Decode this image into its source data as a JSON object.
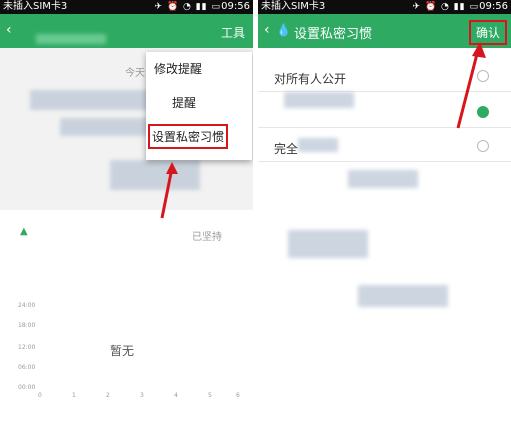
{
  "left": {
    "status": {
      "carrier": "未插入SIM卡3",
      "time": "09:56"
    },
    "appbar": {
      "tools_label": "工具",
      "title": ""
    },
    "menu": {
      "items": [
        {
          "label": "修改提醒"
        },
        {
          "label": "提醒"
        },
        {
          "label": "设置私密习惯"
        }
      ]
    },
    "texts": {
      "today": "今天",
      "kept": "已坚持",
      "pause": "暂无"
    },
    "chart": {
      "y_ticks": [
        "24:00",
        "18:00",
        "12:00",
        "06:00",
        "00:00"
      ],
      "x_ticks": [
        "0",
        "1",
        "2",
        "3",
        "4",
        "5",
        "6"
      ]
    }
  },
  "right": {
    "status": {
      "carrier": "未插入SIM卡3",
      "time": "09:56"
    },
    "appbar": {
      "title": "设置私密习惯",
      "confirm_label": "确认"
    },
    "options": [
      {
        "label": "对所有人公开",
        "selected": false
      },
      {
        "label": "",
        "selected": true
      },
      {
        "label": "完全",
        "selected": false
      }
    ]
  },
  "colors": {
    "accent": "#2eaa63",
    "highlight": "#d6161d"
  }
}
